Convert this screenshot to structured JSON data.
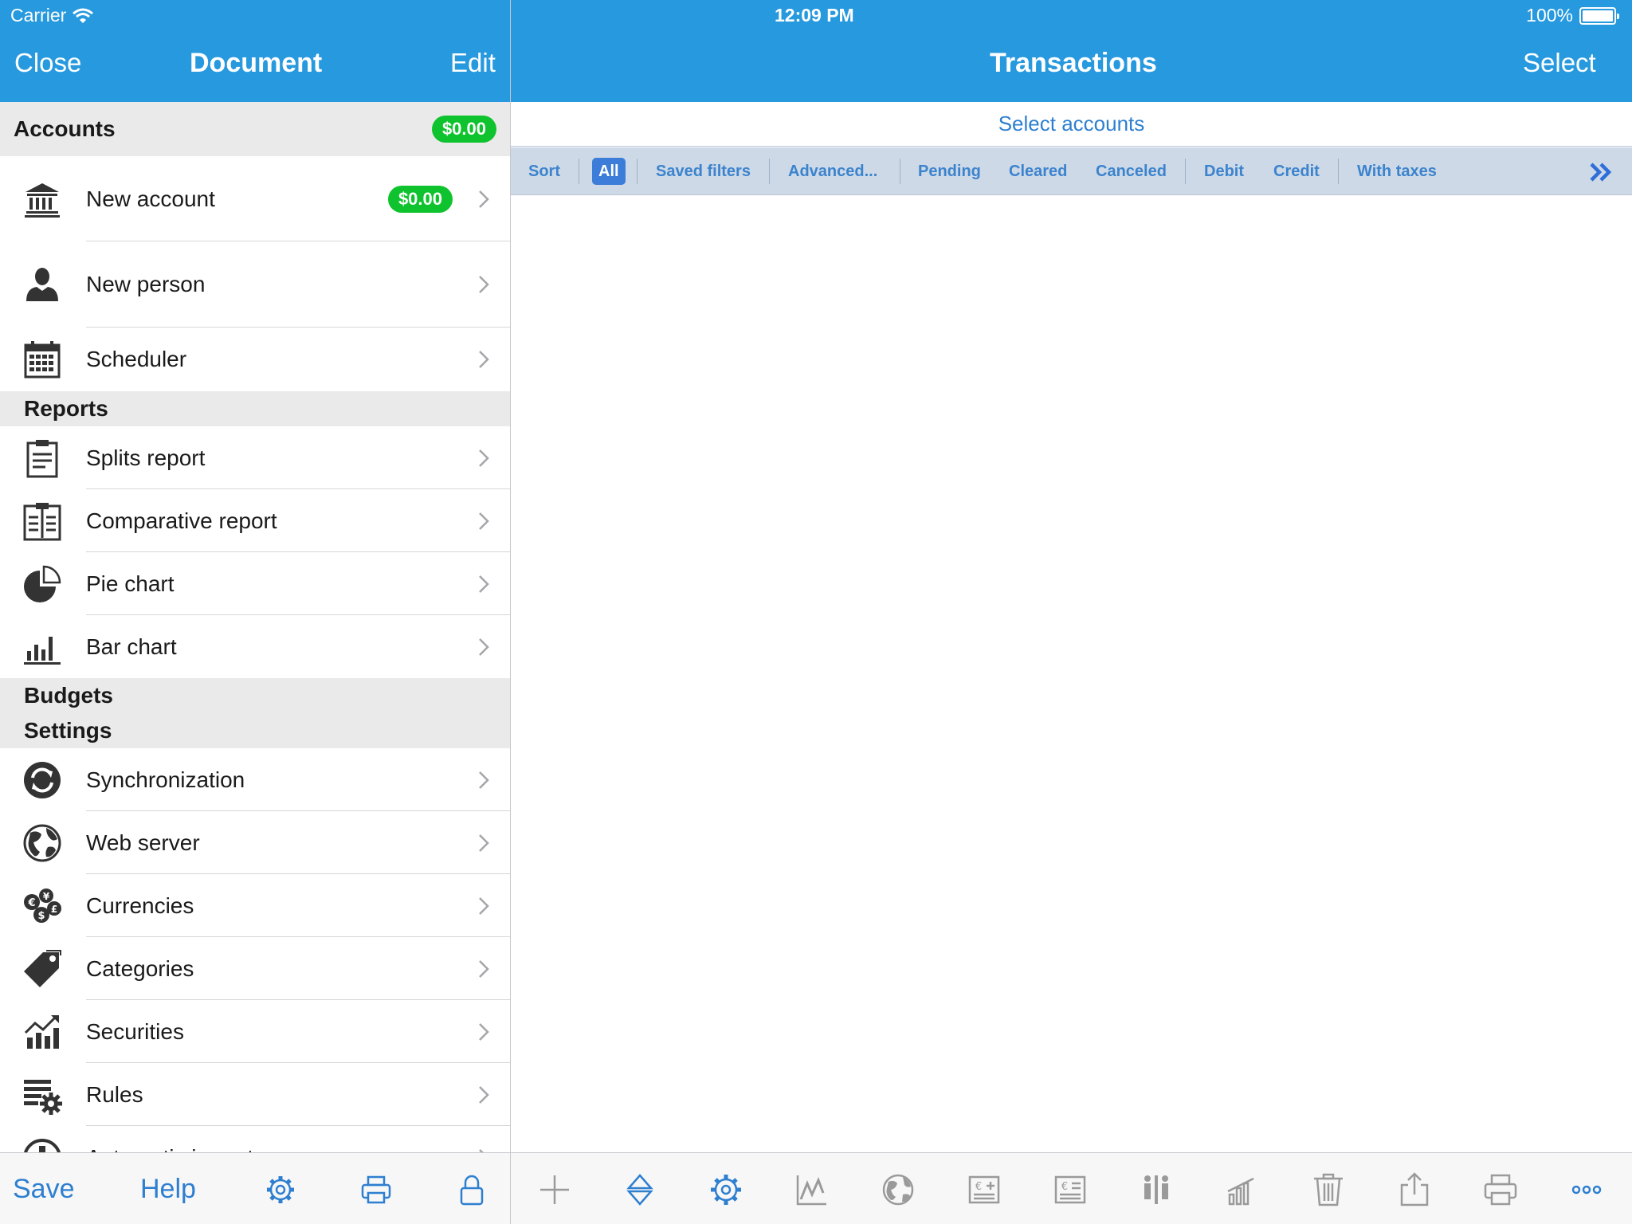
{
  "status_bar": {
    "carrier": "Carrier",
    "time": "12:09 PM",
    "battery": "100%"
  },
  "left_nav": {
    "close": "Close",
    "title": "Document",
    "edit": "Edit"
  },
  "right_nav": {
    "title": "Transactions",
    "select": "Select"
  },
  "accounts": {
    "header": "Accounts",
    "total": "$0.00",
    "items": [
      {
        "label": "New account",
        "badge": "$0.00",
        "icon": "bank-icon"
      },
      {
        "label": "New person",
        "icon": "person-icon"
      },
      {
        "label": "Scheduler",
        "icon": "calendar-icon"
      }
    ]
  },
  "reports": {
    "header": "Reports",
    "items": [
      {
        "label": "Splits report",
        "icon": "clipboard-icon"
      },
      {
        "label": "Comparative report",
        "icon": "comparative-report-icon"
      },
      {
        "label": "Pie chart",
        "icon": "pie-chart-icon"
      },
      {
        "label": "Bar chart",
        "icon": "bar-chart-icon"
      }
    ]
  },
  "budgets": {
    "header": "Budgets"
  },
  "settings": {
    "header": "Settings",
    "items": [
      {
        "label": "Synchronization",
        "icon": "sync-icon"
      },
      {
        "label": "Web server",
        "icon": "globe-icon"
      },
      {
        "label": "Currencies",
        "icon": "currencies-icon"
      },
      {
        "label": "Categories",
        "icon": "tag-icon"
      },
      {
        "label": "Securities",
        "icon": "securities-icon"
      },
      {
        "label": "Rules",
        "icon": "rules-gear-icon"
      },
      {
        "label": "Automatic import",
        "icon": "import-icon"
      }
    ]
  },
  "left_toolbar": {
    "save": "Save",
    "help": "Help",
    "icons": [
      "gear-icon",
      "print-icon",
      "lock-icon"
    ]
  },
  "select_accounts": "Select accounts",
  "filters": {
    "sort": "Sort",
    "all": "All",
    "saved": "Saved filters",
    "advanced": "Advanced...",
    "pending": "Pending",
    "cleared": "Cleared",
    "canceled": "Canceled",
    "debit": "Debit",
    "credit": "Credit",
    "taxes": "With taxes"
  },
  "right_toolbar": {
    "icons": [
      "plus-icon",
      "sort-arrows-icon",
      "gear-icon",
      "line-chart-icon",
      "globe-icon",
      "add-currency-icon",
      "currency-icon",
      "split-icon",
      "bar-chart-icon",
      "trash-icon",
      "share-icon",
      "print-icon",
      "more-icon"
    ]
  },
  "colors": {
    "nav_bar": "#2799de",
    "accent": "#2e7fd0",
    "badge": "#0ec32d",
    "filter_bar": "#cdd9e7",
    "filter_active": "#3c7dd9"
  }
}
